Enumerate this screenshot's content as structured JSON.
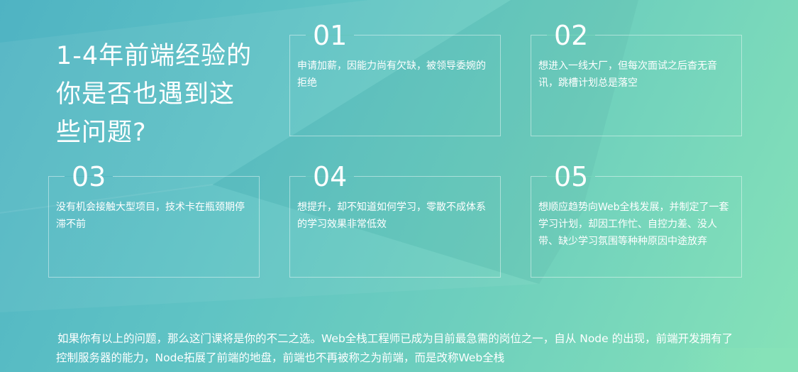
{
  "headline": "1-4年前端经验的\n你是否也遇到这\n些问题?",
  "cards": [
    {
      "num": "01",
      "text": "申请加薪，因能力尚有欠缺，被领导委婉的拒绝"
    },
    {
      "num": "02",
      "text": "想进入一线大厂，但每次面试之后杳无音讯，跳槽计划总是落空"
    },
    {
      "num": "03",
      "text": "没有机会接触大型项目，技术卡在瓶颈期停滞不前"
    },
    {
      "num": "04",
      "text": "想提升，却不知道如何学习，零散不成体系的学习效果非常低效"
    },
    {
      "num": "05",
      "text": "想顺应趋势向Web全栈发展，并制定了一套学习计划，却因工作忙、自控力差、没人带、缺少学习氛围等种种原因中途放弃"
    }
  ],
  "footer": "如果你有以上的问题，那么这门课将是你的不二之选。Web全栈工程师已成为目前最急需的岗位之一，自从 Node 的出现，前端开发拥有了控制服务器的能力，Node拓展了前端的地盘，前端也不再被称之为前端，而是改称Web全栈",
  "colors": {
    "bg_start": "#4fb3c3",
    "bg_end": "#86e2b8",
    "text": "#ffffff"
  }
}
